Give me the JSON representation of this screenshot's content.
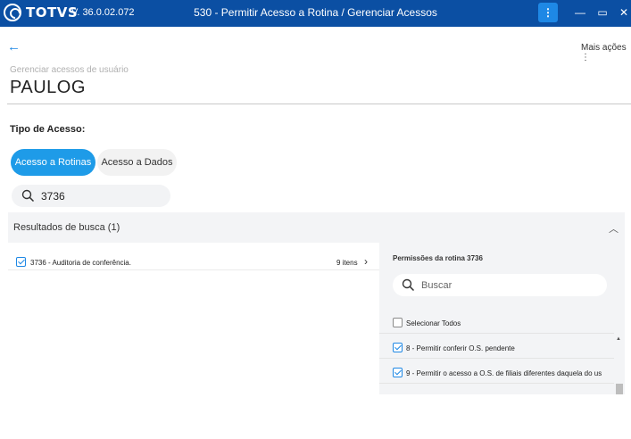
{
  "titlebar": {
    "logo_text": "TOTVS",
    "version": "V. 36.0.02.072",
    "title": "530 - Permitir Acesso a Rotina / Gerenciar Acessos",
    "menu_glyph": "⋮",
    "minimize_glyph": "—",
    "maximize_glyph": "▭",
    "close_glyph": "✕",
    "accent_color": "#0b4fa3"
  },
  "header": {
    "back_glyph": "←",
    "more_actions_label": "Mais ações ⋮",
    "subtitle": "Gerenciar acessos de usuário",
    "username": "PAULOG"
  },
  "access_type": {
    "label": "Tipo de Acesso:",
    "tabs": [
      {
        "label": "Acesso a Rotinas",
        "active": true
      },
      {
        "label": "Acesso a Dados",
        "active": false
      }
    ]
  },
  "search": {
    "value": "3736",
    "icon": "search-icon"
  },
  "results": {
    "header_label": "Resultados de busca (1)",
    "collapse_glyph": "︿",
    "items": [
      {
        "label": "3736 - Auditoria de conferência.",
        "count": "9 itens",
        "checked": true,
        "arrow": "›"
      }
    ]
  },
  "permissions": {
    "title": "Permissões da rotina 3736",
    "search_placeholder": "Buscar",
    "select_all_label": "Selecionar Todos",
    "items": [
      {
        "label": "8 - Permitir conferir O.S. pendente",
        "checked": true
      },
      {
        "label": "9 - Permitir o acesso a O.S. de filiais diferentes daquela do us",
        "checked": true
      }
    ],
    "scroll_up_glyph": "▲"
  }
}
